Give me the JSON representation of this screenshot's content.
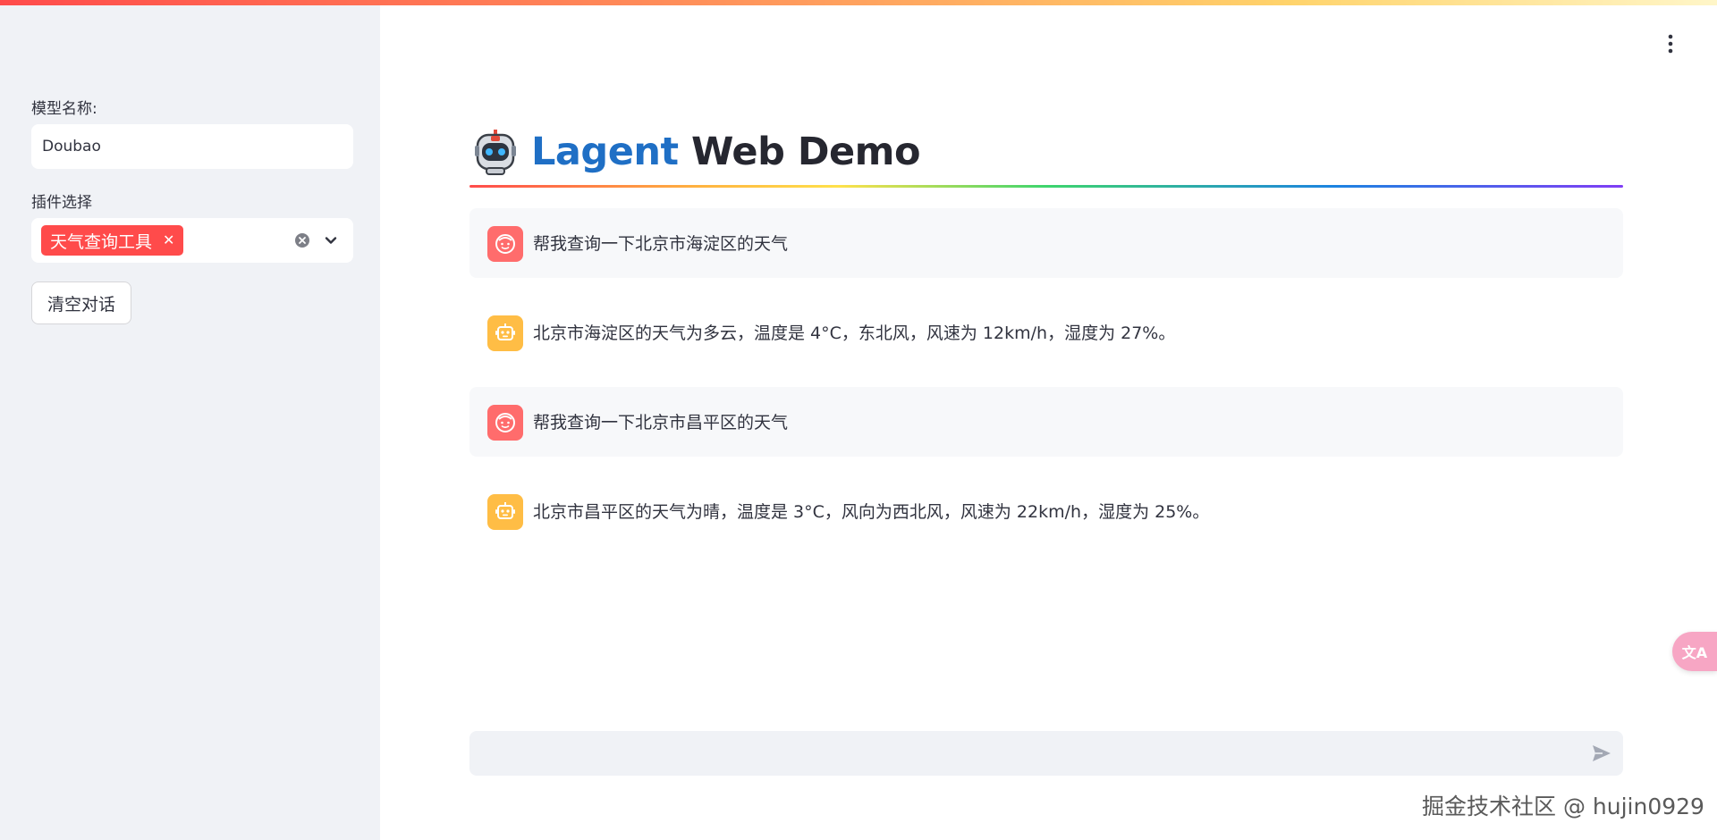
{
  "sidebar": {
    "model_label": "模型名称:",
    "model_value": "Doubao",
    "plugin_label": "插件选择",
    "plugin_tags": [
      "天气查询工具"
    ],
    "clear_button_label": "清空对话"
  },
  "main": {
    "title_accent": "Lagent",
    "title_rest": "Web Demo",
    "messages": [
      {
        "role": "user",
        "text": "帮我查询一下北京市海淀区的天气"
      },
      {
        "role": "assistant",
        "text": "北京市海淀区的天气为多云，温度是 4°C，东北风，风速为 12km/h，湿度为 27%。"
      },
      {
        "role": "user",
        "text": "帮我查询一下北京市昌平区的天气"
      },
      {
        "role": "assistant",
        "text": "北京市昌平区的天气为晴，温度是 3°C，风向为西北风，风速为 22km/h，湿度为 25%。"
      }
    ],
    "chat_input_placeholder": ""
  },
  "translate_button_label": "文A",
  "watermark": "掘金技术社区 @ hujin0929",
  "colors": {
    "accent": "#ff4b4b",
    "title_blue": "#1f6fc5",
    "user_avatar": "#ff6c6c",
    "bot_avatar": "#ffbd45",
    "sidebar_bg": "#f0f2f6"
  },
  "icons": {
    "menu": "vertical-dots-icon",
    "title": "robot-icon",
    "user_avatar": "smiley-face-icon",
    "bot_avatar": "robot-face-icon",
    "send": "send-icon",
    "clear": "clear-circle-icon",
    "dropdown": "chevron-down-icon",
    "translate": "translate-icon"
  }
}
